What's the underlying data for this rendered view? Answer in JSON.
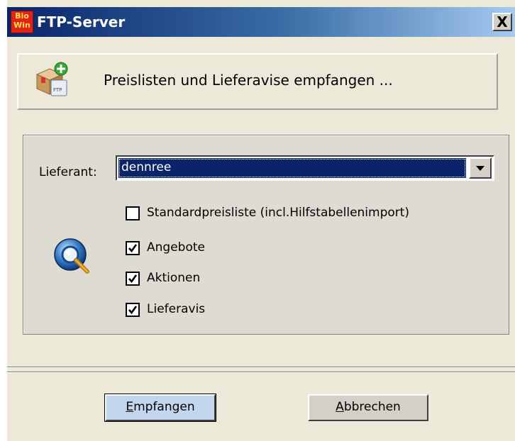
{
  "window": {
    "app_logo_line1": "Bio",
    "app_logo_line2": "Win",
    "title": "FTP-Server",
    "close_label": "X"
  },
  "header": {
    "text": "Preislisten und Lieferavise empfangen ..."
  },
  "form": {
    "supplier_label": "Lieferant:",
    "supplier_value": "dennree",
    "options": [
      {
        "label": "Standardpreisliste (incl.Hilfstabellenimport)",
        "checked": false
      },
      {
        "label": "Angebote",
        "checked": true
      },
      {
        "label": "Aktionen",
        "checked": true
      },
      {
        "label": "Lieferavis",
        "checked": true
      }
    ]
  },
  "buttons": {
    "receive_first": "E",
    "receive_rest": "mpfangen",
    "cancel_first": "A",
    "cancel_rest": "bbrechen"
  },
  "colors": {
    "title_start": "#0a246a",
    "title_end": "#a6caf0",
    "selection": "#0a246a",
    "dialog_bg": "#ece9d8"
  }
}
